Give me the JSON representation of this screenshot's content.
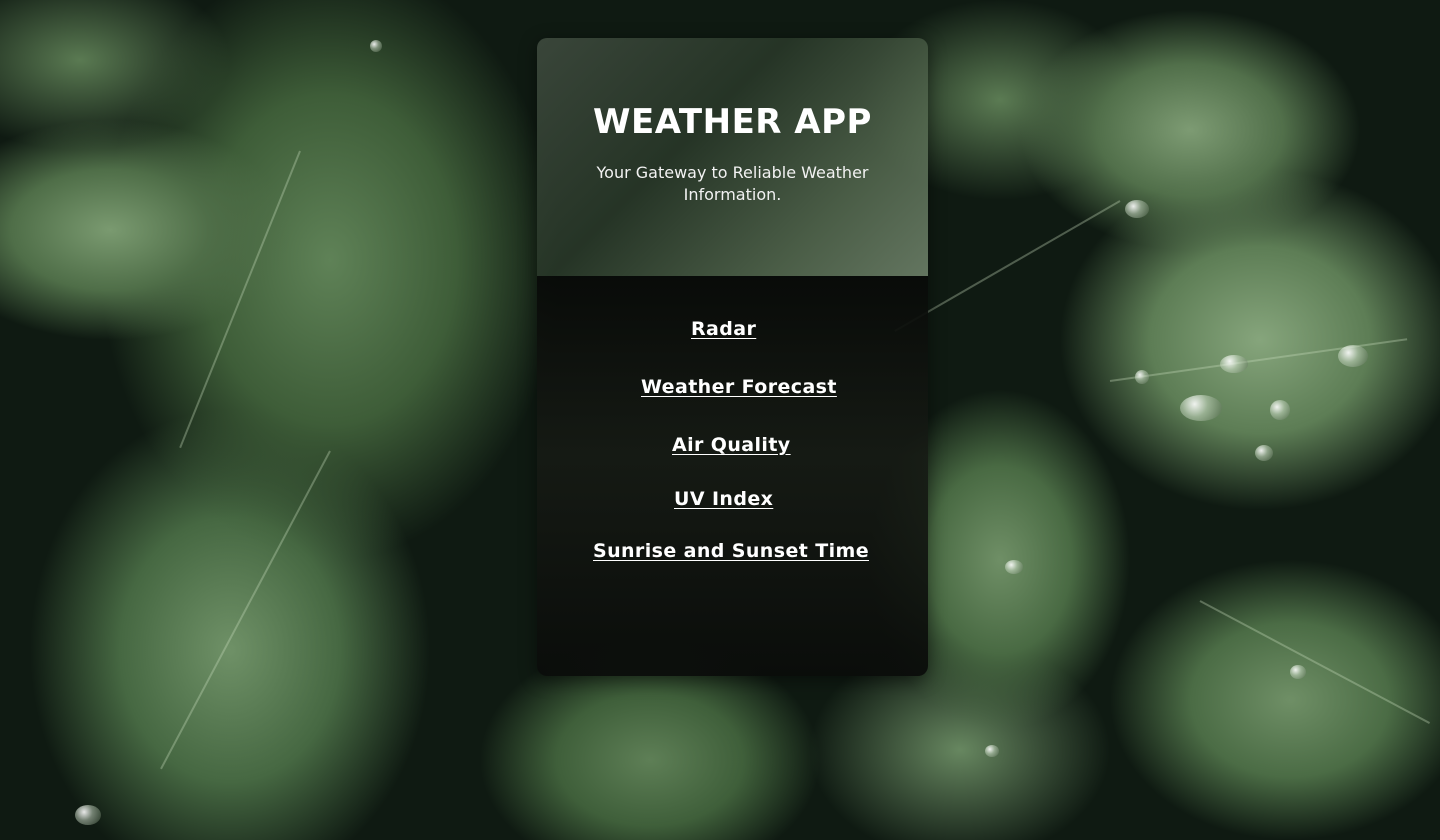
{
  "header": {
    "title": "WEATHER APP",
    "subtitle": "Your Gateway to Reliable Weather Information."
  },
  "nav": {
    "links": [
      {
        "label": "Radar"
      },
      {
        "label": "Weather Forecast"
      },
      {
        "label": "Air Quality"
      },
      {
        "label": "UV Index"
      },
      {
        "label": "Sunrise and Sunset Time"
      }
    ]
  },
  "colors": {
    "text": "#ffffff",
    "card_header": "#3c483c",
    "card_body": "#080a08",
    "background": "#0f1a12"
  },
  "background_image": "leaf-background"
}
